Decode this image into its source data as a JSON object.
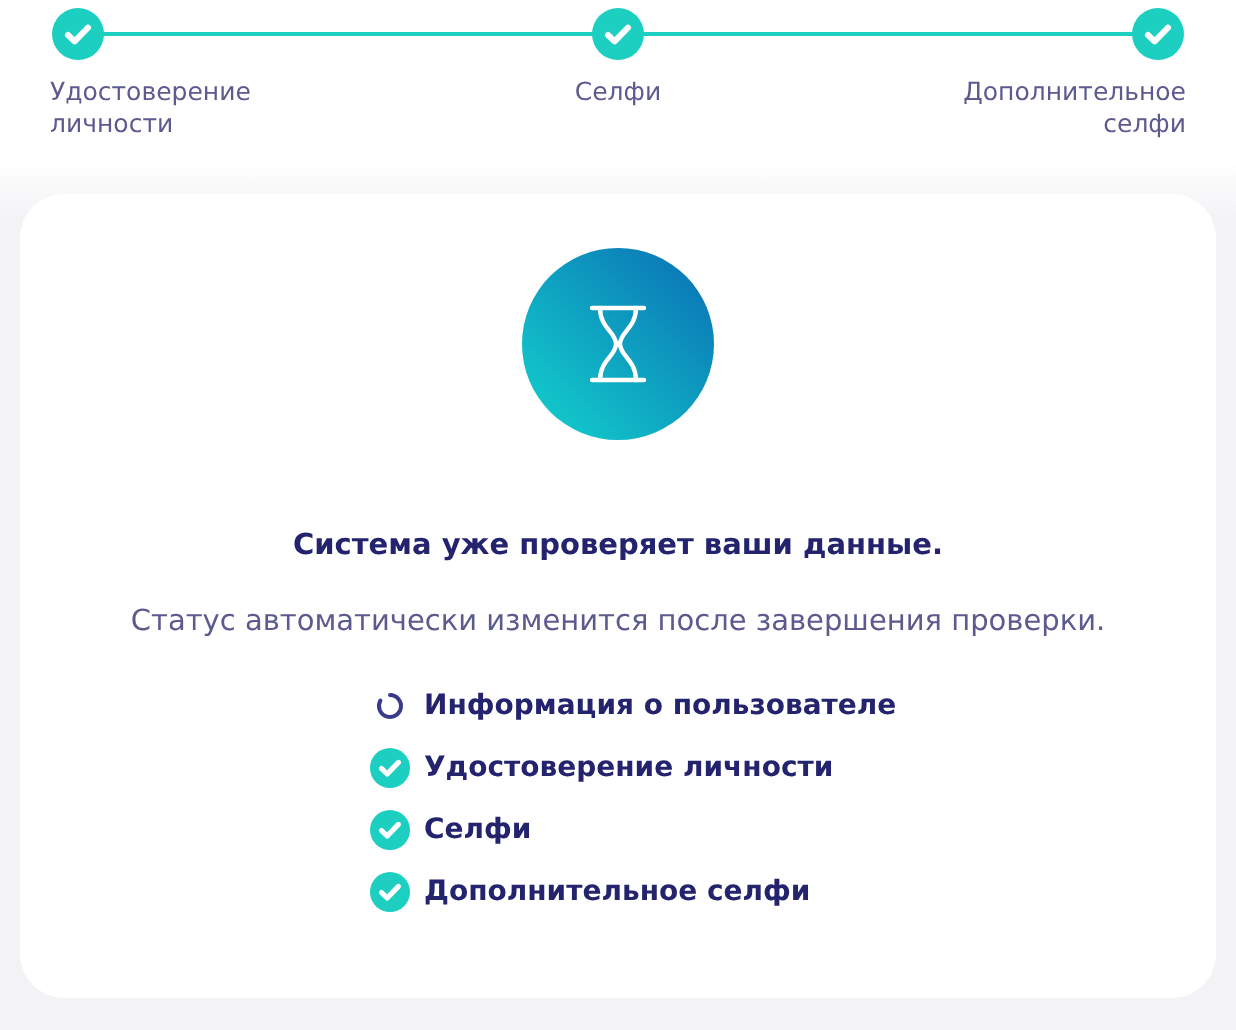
{
  "steps": [
    {
      "label": "Удостоверение личности",
      "done": true
    },
    {
      "label": "Селфи",
      "done": true
    },
    {
      "label": "Дополнительное селфи",
      "done": true
    }
  ],
  "card": {
    "title": "Система уже проверяет ваши данные.",
    "subtitle": "Статус автоматически изменится после завершения проверки.",
    "checks": [
      {
        "label": "Информация о пользователе",
        "done": false
      },
      {
        "label": "Удостоверение личности",
        "done": true
      },
      {
        "label": "Селфи",
        "done": true
      },
      {
        "label": "Дополнительное селфи",
        "done": true
      }
    ]
  }
}
